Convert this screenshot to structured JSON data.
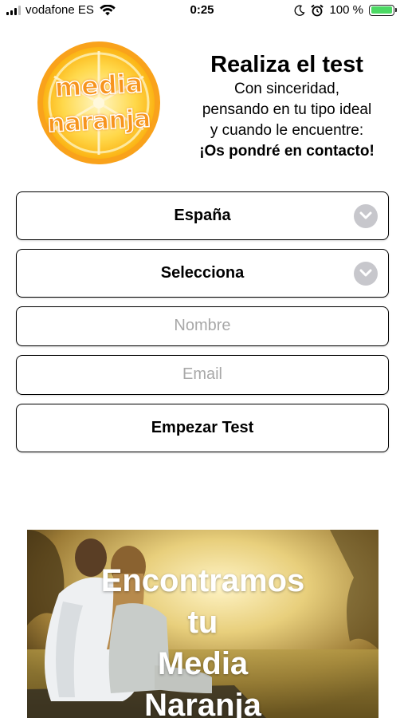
{
  "status_bar": {
    "carrier": "vodafone ES",
    "time": "0:25",
    "battery": "100 %",
    "battery_level": 1.0
  },
  "logo": {
    "line1": "media",
    "line2": "naranja"
  },
  "header": {
    "title": "Realiza el test",
    "line1": "Con sinceridad,",
    "line2": "pensando en tu tipo ideal",
    "line3": "y cuando le encuentre:",
    "cta": "¡Os pondré en contacto!"
  },
  "form": {
    "country_value": "España",
    "gender_value": "Selecciona",
    "name_placeholder": "Nombre",
    "email_placeholder": "Email",
    "submit_label": "Empezar Test"
  },
  "banner": {
    "line1": "Encontramos",
    "line2": "tu",
    "line3": "Media",
    "line4": "Naranja"
  },
  "colors": {
    "accent_orange": "#f7941d",
    "chevron_gray": "#c7c7cc",
    "battery_green": "#4cd964"
  }
}
